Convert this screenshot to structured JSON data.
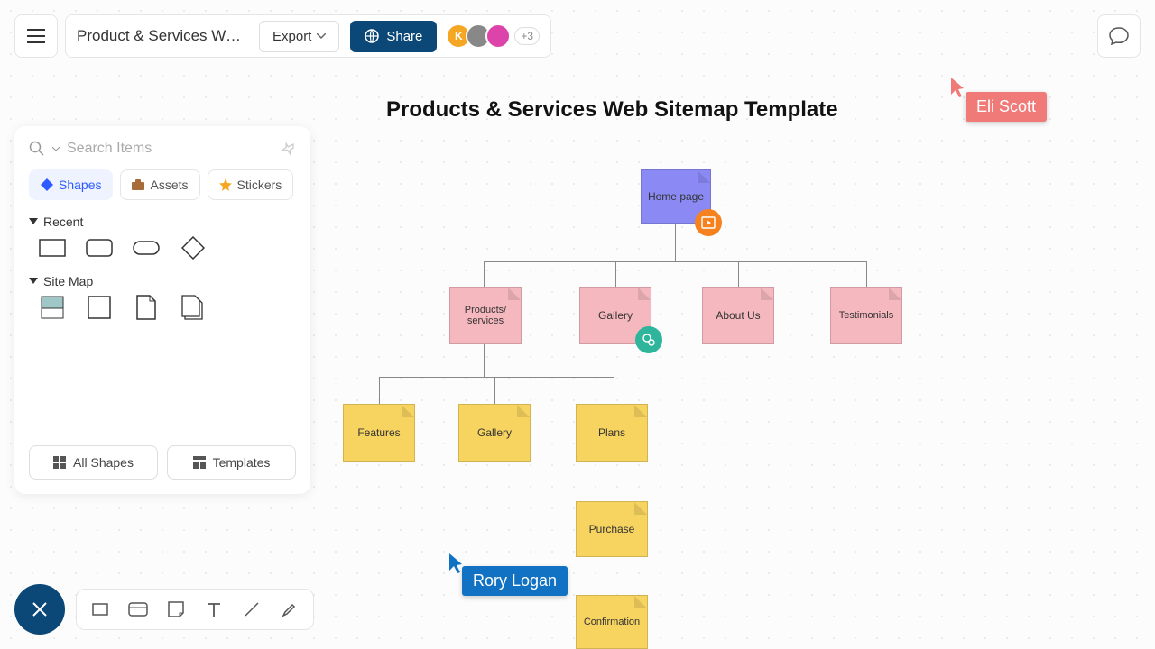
{
  "header": {
    "doc_title": "Product & Services Web…",
    "export_label": "Export",
    "share_label": "Share",
    "more_count": "+3"
  },
  "side": {
    "search_placeholder": "Search Items",
    "tabs": {
      "shapes": "Shapes",
      "assets": "Assets",
      "stickers": "Stickers"
    },
    "groups": {
      "recent": "Recent",
      "sitemap": "Site Map"
    },
    "buttons": {
      "all_shapes": "All Shapes",
      "templates": "Templates"
    }
  },
  "canvas": {
    "title": "Products & Services Web Sitemap Template",
    "nodes": {
      "home": "Home page",
      "products": "Products/\nservices",
      "gallery1": "Gallery",
      "about": "About Us",
      "testimonials": "Testimonials",
      "features": "Features",
      "gallery2": "Gallery",
      "plans": "Plans",
      "purchase": "Purchase",
      "confirmation": "Confirmation"
    },
    "collaborators": {
      "eli": "Eli Scott",
      "rory": "Rory Logan"
    }
  },
  "colors": {
    "purple": "#8b8af5",
    "pink": "#f5b8bf",
    "yellow": "#f7d360",
    "orange": "#f5821f",
    "teal": "#2eb59b",
    "red_tag": "#ef7a78",
    "blue_tag": "#1172c4"
  }
}
